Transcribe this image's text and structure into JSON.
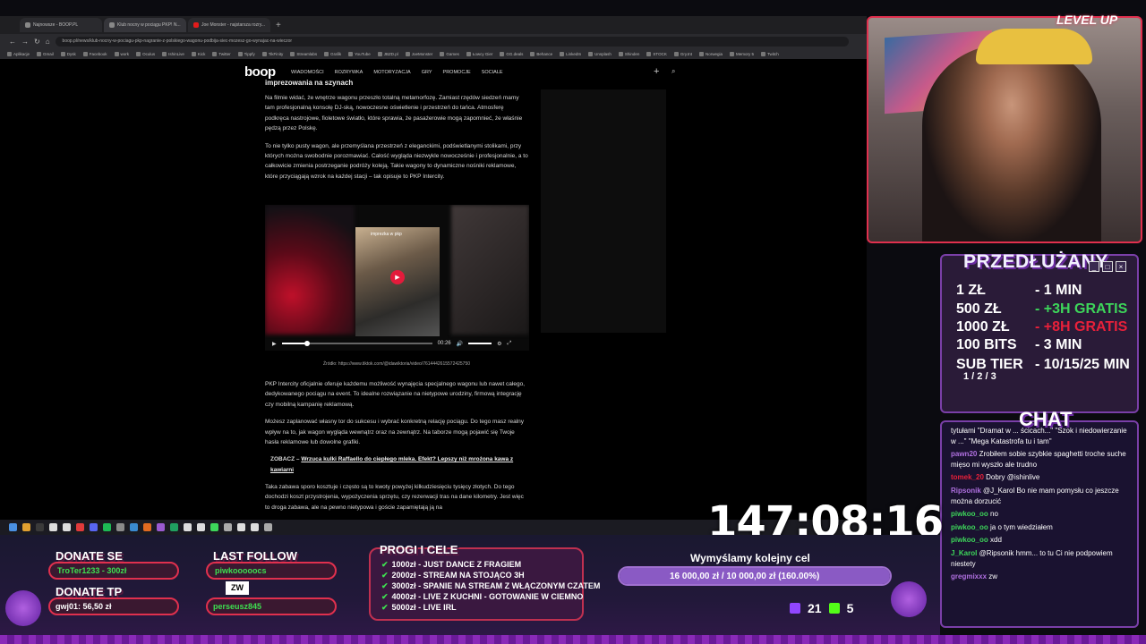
{
  "browser": {
    "tabs": [
      {
        "label": "Najnowsze - BOOP.PL",
        "favicon": "boop-icon"
      },
      {
        "label": "Klub nocny w pociągu PKP! N...",
        "favicon": "boop-icon"
      },
      {
        "label": "Joe Monster - najstarsza rozry...",
        "favicon": "joemonster-icon"
      }
    ],
    "new_tab": "+",
    "url": "boop.pl/news/klub-nocny-w-pociagu-pkp-nagranie-z-polskiego-wagonu-podbija-siec-mozesz-go-wynajac-na-wieczor",
    "bookmarks": [
      "Aplikacje",
      "Gmail",
      "Dysk",
      "Facebook",
      "work",
      "Oculus",
      "IshinLive",
      "Kick",
      "Twitter",
      "Tippfy",
      "TikFinity",
      "Streamlabs",
      "Grafik",
      "YouTube",
      "JBZD.pl",
      "JoeMonster",
      "Games",
      "Łowcy Gier",
      "GG.deals",
      "Behance",
      "LinkedIn",
      "Unsplash",
      "Shinden",
      "STOCK",
      "Gry.tnt",
      "Norwegia",
      "Memory 5",
      "Twitch"
    ]
  },
  "site": {
    "logo": "boop",
    "nav": [
      "WIADOMOŚCI",
      "ROZRYWKA",
      "MOTORYZACJA",
      "GRY",
      "PROMOCJE",
      "SOCIALE"
    ]
  },
  "article": {
    "heading_fragment": "imprezowania na szynach",
    "paragraphs": [
      "Na filmie widać, że wnętrze wagonu przeszło totalną metamorfozę. Zamiast rzędów siedzeń mamy tam profesjonalną konsolę DJ-ską, nowoczesne oświetlenie i przestrzeń do tańca. Atmosferę podkręca nastrojowe, fioletowe światło, które sprawia, że pasażerowie mogą zapomnieć, że właśnie pędzą przez Polskę.",
      "To nie tylko pusty wagon, ale przemyślana przestrzeń z eleganckimi, podświetlanymi stolikami, przy których można swobodnie porozmawiać. Całość wygląda niezwykle nowocześnie i profesjonalnie, a to całkowicie zmienia postrzeganie podróży koleją. Takie wagony to dynamiczne nośniki reklamowe, które przyciągają wzrok na każdej stacji – tak opisuje to PKP Intercity."
    ],
    "video": {
      "caption": "imprezka w pkp",
      "time": "00:26",
      "progress": 0.15,
      "source": "Źródło: https://www.tiktok.com/@idawiktoria/video/7614442615572425750"
    },
    "paragraphs2": [
      "PKP Intercity oficjalnie oferuje każdemu możliwość wynajęcia specjalnego wagonu lub nawet całego, dedykowanego pociągu na event. To idealne rozwiązanie na nietypowe urodziny, firmową integrację czy mobilną kampanię reklamową.",
      "Możesz zaplanować własny tor do sukcesu i wybrać konkretną relację pociągu. Do tego masz realny wpływ na to, jak wagon wygląda wewnątrz oraz na zewnątrz. Na taborze mogą pojawić się Twoje hasła reklamowe lub dowolne grafiki."
    ],
    "zobacz_label": "ZOBACZ – ",
    "zobacz_link": "Wrzuca kulki Raffaello do ciepłego mleka. Efekt? Lepszy niż mrożona kawa z kawiarni",
    "paragraph3": "Taka zabawa sporo kosztuje i często są to kwoty powyżej kilkudziesięciu tysięcy złotych. Do tego dochodzi koszt przystrojenia, wypożyczenia sprzętu, czy rezerwacji tras na dane kilometry. Jest więc to droga zabawa, ale na pewno nietypowa i goście zapamiętają ją na"
  },
  "overlay": {
    "brand": "LEVEL UP",
    "subathon_title": "PRZEDŁUŻANY",
    "subathon_rows": [
      {
        "amount": "1 ZŁ",
        "value": "- 1 MIN",
        "color": "#ffffff"
      },
      {
        "amount": "500 ZŁ",
        "value": "- +3H GRATIS",
        "color": "#3dd65a"
      },
      {
        "amount": "1000 ZŁ",
        "value": "- +8H GRATIS",
        "color": "#e8203a"
      },
      {
        "amount": "100 BITS",
        "value": "- 3 MIN",
        "color": "#ffffff"
      },
      {
        "amount": "SUB TIER",
        "value": "- 10/15/25 MIN",
        "color": "#ffffff"
      }
    ],
    "sub_tier_levels": "1 / 2 / 3",
    "chat_title": "CHAT",
    "chat": [
      {
        "user": "",
        "text": "tytułami \"Dramat w ... ścicach...\" \"Szok i niedowierzanie w ...\" \"Mega Katastrofa tu i tam\"",
        "color": "#ffffff"
      },
      {
        "user": "pawn20",
        "text": "Zrobiłem sobie szybkie spaghetti troche suche mięso mi wyszło ale trudno",
        "color": "#b070e0"
      },
      {
        "user": "tomek_20",
        "text": "Dobry @ishinlive",
        "color": "#e8203a"
      },
      {
        "user": "Ripsonik",
        "text": "@J_Karol Bo nie mam pomysłu co jeszcze można dorzucić",
        "color": "#b070e0"
      },
      {
        "user": "piwkoo_oo",
        "text": "no",
        "color": "#3dd65a"
      },
      {
        "user": "piwkoo_oo",
        "text": "ja o tym wiedziałem",
        "color": "#3dd65a"
      },
      {
        "user": "piwkoo_oo",
        "text": "xdd",
        "color": "#3dd65a"
      },
      {
        "user": "J_Karol",
        "text": "@Ripsonik hmm... to tu Ci nie podpowiem niestety",
        "color": "#3dd65a"
      },
      {
        "user": "gregmixxx",
        "text": "zw",
        "color": "#b070e0"
      }
    ],
    "timer": "147:08:16",
    "donate_se_label": "DONATE SE",
    "donate_se_value": "TroTer1233 - 300zł",
    "donate_tp_label": "DONATE TP",
    "donate_tp_value": "gwj01: 56,50 zł",
    "last_follow_label": "LAST FOLLOW",
    "last_follow_value": "piwkooooocs",
    "last_sub_value": "perseusz845",
    "zw_badge": "ZW",
    "progi_title": "PROGI I CELE",
    "progi": [
      "1000zł - JUST DANCE Z FRAGIEM",
      "2000zł - STREAM NA STOJĄCO 3H",
      "3000zł - SPANIE NA STREAM Z WŁĄCZONYM CZATEM",
      "4000zł - LIVE Z KUCHNI - GOTOWANIE W CIEMNO",
      "5000zł - LIVE IRL"
    ],
    "goal_title": "Wymyślamy kolejny cel",
    "goal_text": "16 000,00 zł / 10 000,00 zł (160.00%)",
    "goal_progress": 1.0,
    "twitch_viewers": "21",
    "kick_viewers": "5"
  }
}
